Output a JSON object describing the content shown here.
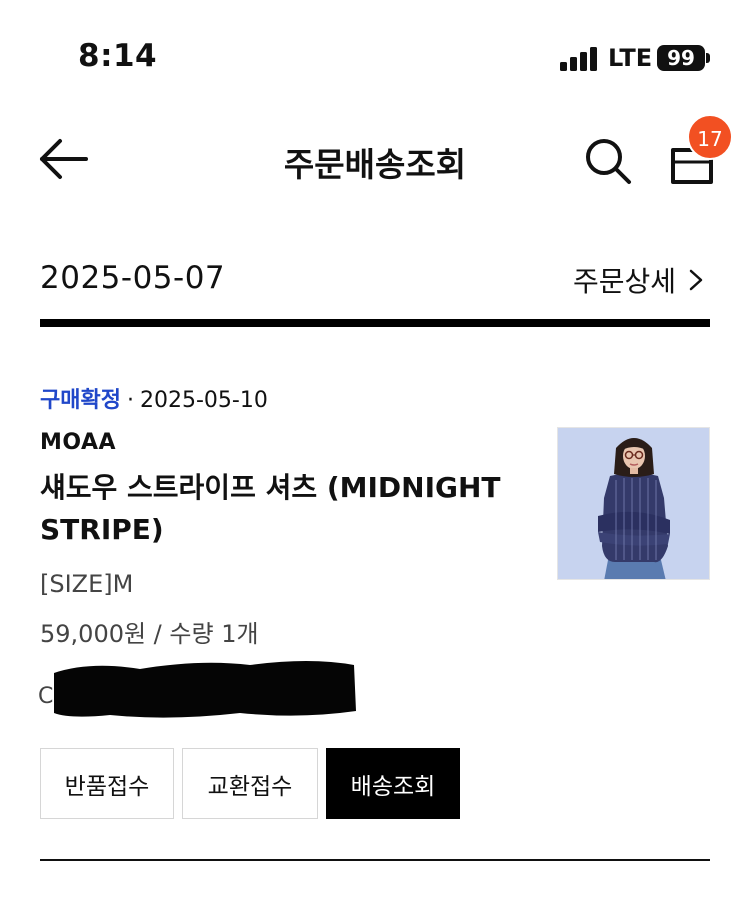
{
  "status_bar": {
    "time": "8:14",
    "network": "LTE",
    "battery": "99"
  },
  "header": {
    "title": "주문배송조회",
    "cart_count": "17"
  },
  "order": {
    "date": "2025-05-07",
    "detail_link": "주문상세",
    "item": {
      "status": "구매확정",
      "separator": "·",
      "status_date": "2025-05-10",
      "brand": "MOAA",
      "name": "섀도우 스트라이프 셔츠 (MIDNIGHT STRIPE)",
      "option": "[SIZE]M",
      "price_qty": "59,000원 / 수량 1개",
      "redacted_prefix": "C"
    },
    "actions": {
      "return_label": "반품접수",
      "exchange_label": "교환접수",
      "track_label": "배송조회"
    }
  },
  "colors": {
    "accent_status": "#2047c9",
    "badge": "#f25022",
    "primary_button": "#000000"
  },
  "icons": [
    "back-arrow-icon",
    "search-icon",
    "shopping-bag-icon",
    "chevron-right-icon",
    "signal-icon"
  ]
}
